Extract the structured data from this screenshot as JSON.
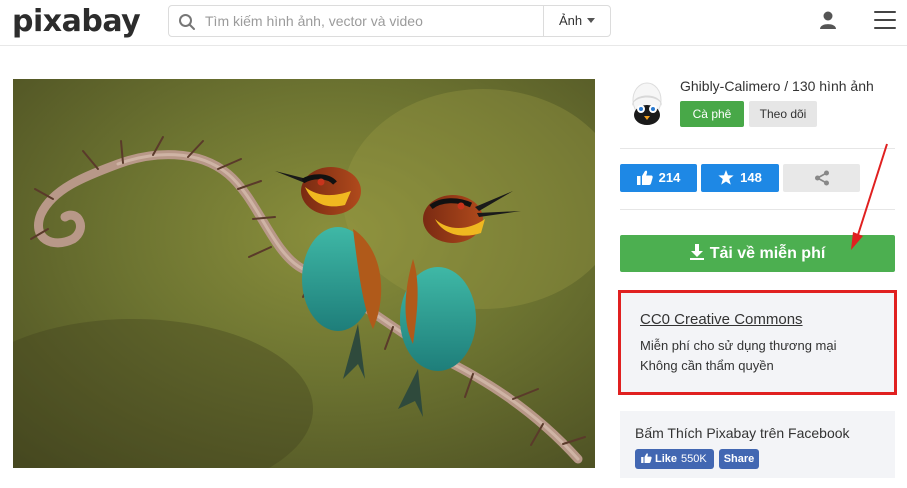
{
  "header": {
    "logo": "pixabay",
    "search_placeholder": "Tìm kiếm hình ảnh, vector và video",
    "search_type": "Ảnh"
  },
  "author": {
    "name_line": "Ghibly-Calimero / 130 hình ảnh",
    "coffee_label": "Cà phê",
    "follow_label": "Theo dõi"
  },
  "stats": {
    "likes": "214",
    "favorites": "148"
  },
  "download": {
    "label": "Tải về miễn phí"
  },
  "license": {
    "title": "CC0 Creative Commons",
    "line1": "Miễn phí cho sử dụng thương mại",
    "line2": "Không cần thẩm quyền"
  },
  "facebook": {
    "text": "Bấm Thích Pixabay trên Facebook",
    "like_label": "Like",
    "like_count": "550K",
    "share_label": "Share"
  },
  "colors": {
    "download_green": "#4caf50",
    "stat_blue": "#1e88e5",
    "highlight_red": "#e02020",
    "facebook_blue": "#4267b2"
  },
  "icons": [
    "search-icon",
    "user-icon",
    "menu-icon",
    "thumbs-up-icon",
    "star-icon",
    "share-icon",
    "download-icon",
    "facebook-icon"
  ]
}
